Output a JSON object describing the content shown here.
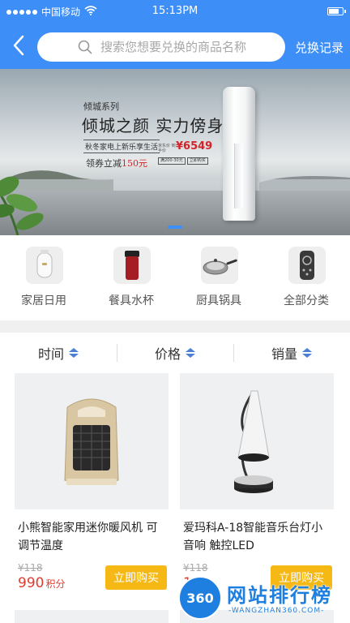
{
  "status_bar": {
    "carrier": "中国移动",
    "time": "15:13PM",
    "battery_level": 0.85
  },
  "nav": {
    "back_icon": "chevron-left-icon",
    "search_placeholder": "搜索您想要兑换的商品名称",
    "exchange_record": "兑换记录"
  },
  "banner": {
    "series": "倾城系列",
    "title": "倾城之颜  实力傍身",
    "subtitle": "秋冬家电上新乐享生活",
    "coupon_prefix": "领券立减",
    "coupon_amount": "150元",
    "price_small": "京东价 到手价",
    "price": "¥6549",
    "tags": [
      "满200-30元",
      "立即购买"
    ],
    "active_slide": 1
  },
  "categories": [
    {
      "label": "家居日用",
      "icon": "humidifier-icon"
    },
    {
      "label": "餐具水杯",
      "icon": "thermos-cup-icon"
    },
    {
      "label": "厨具锅具",
      "icon": "frying-pan-icon"
    },
    {
      "label": "全部分类",
      "icon": "remote-control-icon"
    }
  ],
  "sort": [
    {
      "label": "时间"
    },
    {
      "label": "价格"
    },
    {
      "label": "销量"
    }
  ],
  "products": [
    {
      "name": "小熊智能家用迷你暖风机 可调节温度",
      "old_price": "¥118",
      "points": "990",
      "points_unit": "积分",
      "buy_label": "立即购买",
      "image": "space-heater-icon"
    },
    {
      "name": "爱玛科A-18智能音乐台灯小音响 触控LED",
      "old_price": "¥118",
      "points": "1",
      "points_unit": "积分",
      "buy_label": "立即购买",
      "image": "desk-lamp-speaker-icon"
    }
  ],
  "watermark": {
    "badge": "360",
    "text": "网站排行榜",
    "url": "-WANGZHAN360.COM-"
  }
}
